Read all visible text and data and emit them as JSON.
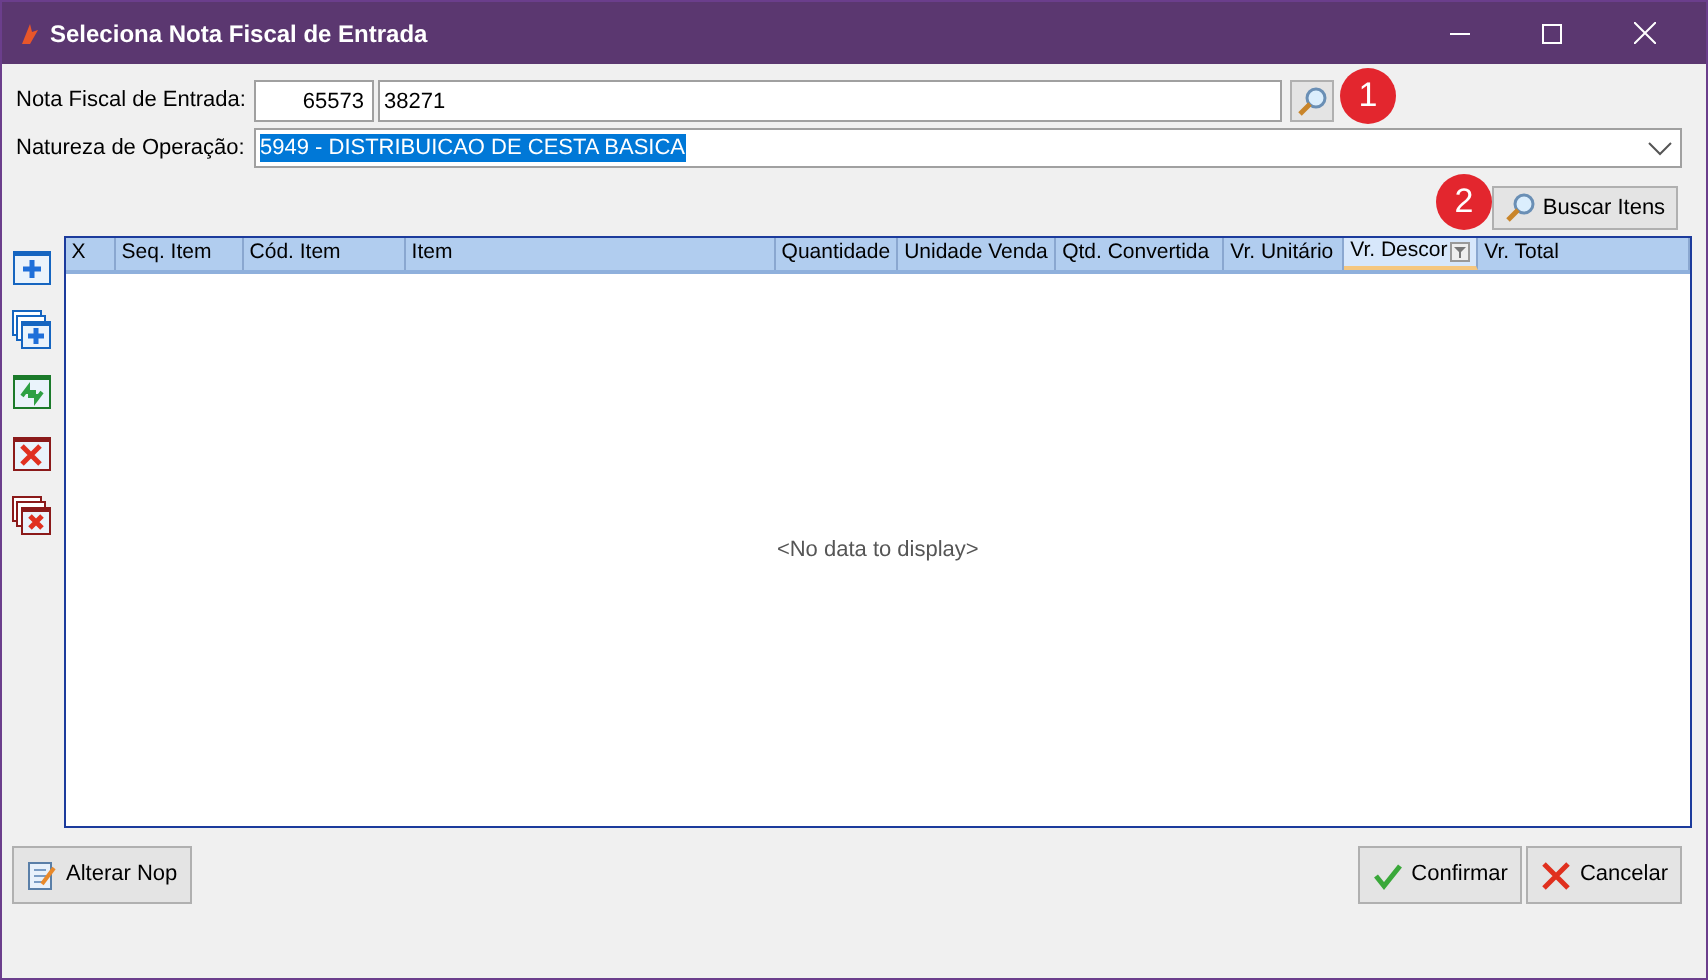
{
  "window": {
    "title": "Seleciona Nota Fiscal de Entrada"
  },
  "nota_fiscal": {
    "label": "Nota Fiscal de Entrada:",
    "code": "65573",
    "number": "38271"
  },
  "natureza": {
    "label": "Natureza de Operação:",
    "value": "5949 - DISTRIBUICAO DE CESTA BASICA"
  },
  "badges": [
    "1",
    "2"
  ],
  "search_items_button": "Buscar Itens",
  "side_tools": [
    {
      "kind": "add"
    },
    {
      "kind": "add-multiple"
    },
    {
      "kind": "refresh"
    },
    {
      "kind": "delete"
    },
    {
      "kind": "delete-multiple"
    }
  ],
  "table": {
    "columns": [
      {
        "label": "X",
        "hot": false
      },
      {
        "label": "Seq. Item",
        "hot": false
      },
      {
        "label": "Cód. Item",
        "hot": false
      },
      {
        "label": "Item",
        "hot": false
      },
      {
        "label": "Quantidade",
        "hot": false
      },
      {
        "label": "Unidade Venda",
        "hot": false
      },
      {
        "label": "Qtd. Convertida",
        "hot": false
      },
      {
        "label": "Vr. Unitário",
        "hot": false
      },
      {
        "label": "Vr. Descor",
        "hot": true
      },
      {
        "label": "Vr. Total",
        "hot": false
      }
    ],
    "empty_text": "<No data to display>"
  },
  "buttons": {
    "change": "Alterar Nop",
    "confirm": "Confirmar",
    "cancel": "Cancelar"
  }
}
